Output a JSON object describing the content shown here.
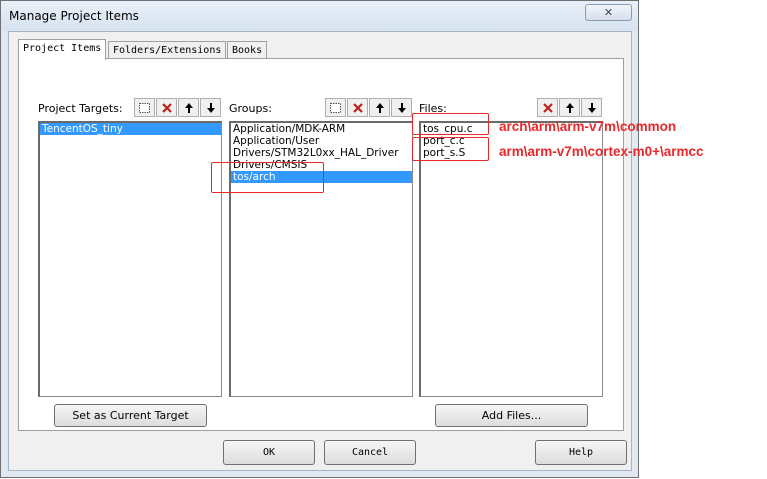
{
  "window": {
    "title": "Manage Project Items",
    "close_label": "✕"
  },
  "tabs": [
    {
      "label": "Project Items",
      "active": true
    },
    {
      "label": "Folders/Extensions",
      "active": false
    },
    {
      "label": "Books",
      "active": false
    }
  ],
  "targets": {
    "header": "Project Targets:",
    "items": [
      {
        "label": "TencentOS_tiny",
        "selected": true
      }
    ],
    "set_current_label": "Set as Current Target"
  },
  "groups": {
    "header": "Groups:",
    "items": [
      {
        "label": "Application/MDK-ARM",
        "selected": false
      },
      {
        "label": "Application/User",
        "selected": false
      },
      {
        "label": "Drivers/STM32L0xx_HAL_Driver",
        "selected": false
      },
      {
        "label": "Drivers/CMSIS",
        "selected": false
      },
      {
        "label": "tos/arch",
        "selected": true
      }
    ]
  },
  "files": {
    "header": "Files:",
    "items": [
      {
        "label": "tos_cpu.c"
      },
      {
        "label": "port_c.c"
      },
      {
        "label": "port_s.S"
      }
    ],
    "add_files_label": "Add Files..."
  },
  "annotations": {
    "line1": "arch\\arm\\arm-v7m\\common",
    "line2": "arm\\arm-v7m\\cortex-m0+\\armcc",
    "color": "#e8282a"
  },
  "dialog_buttons": {
    "ok": "OK",
    "cancel": "Cancel",
    "help": "Help"
  },
  "colors": {
    "selection": "#3399ff",
    "delete": "#c0201c"
  }
}
